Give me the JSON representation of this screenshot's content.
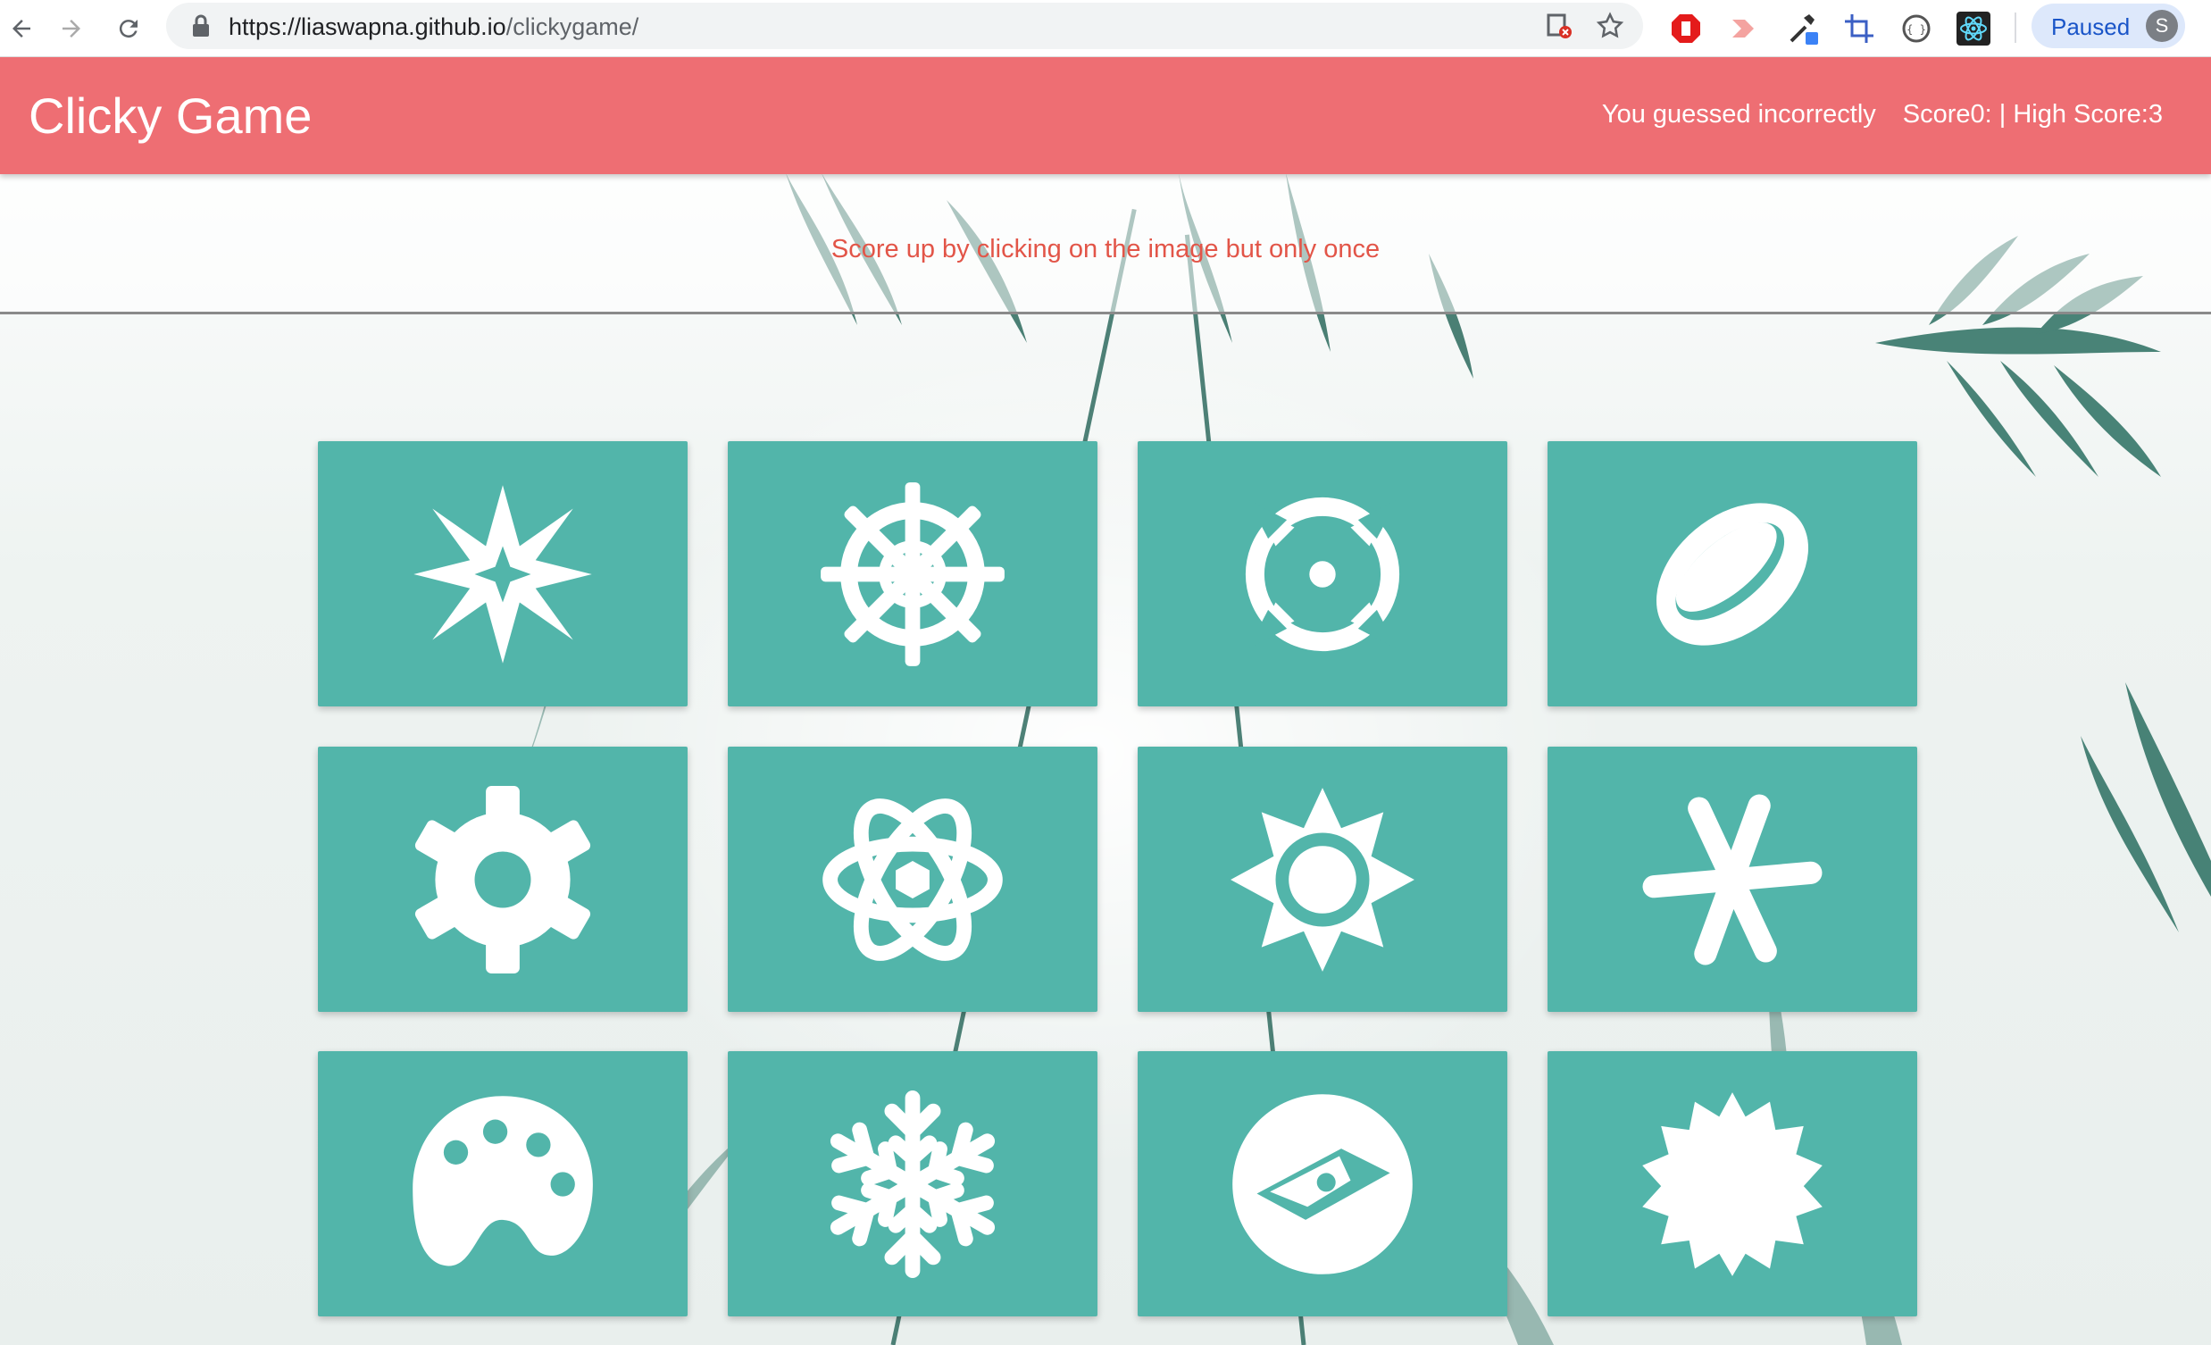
{
  "browser": {
    "url_host": "https://liaswapna.github.io",
    "url_path": "/clickygame/",
    "paused_label": "Paused",
    "avatar_letter": "S"
  },
  "navbar": {
    "brand": "Clicky Game",
    "guess_message": "You guessed incorrectly",
    "score_text": "Score0: | High Score:3"
  },
  "instruction": "Score up by clicking on the image but only once",
  "theme": {
    "navbar_color": "#ee6e73",
    "card_color": "#52b5aa",
    "instruction_color": "#e25548"
  },
  "cards": [
    {
      "icon": "spiky-star-icon"
    },
    {
      "icon": "ship-wheel-icon"
    },
    {
      "icon": "crosshair-target-icon"
    },
    {
      "icon": "ring-icon"
    },
    {
      "icon": "gear-icon"
    },
    {
      "icon": "atom-icon"
    },
    {
      "icon": "sun-icon"
    },
    {
      "icon": "asterisk-icon"
    },
    {
      "icon": "palette-icon"
    },
    {
      "icon": "snowflake-icon"
    },
    {
      "icon": "compass-icon"
    },
    {
      "icon": "starburst-icon"
    }
  ]
}
